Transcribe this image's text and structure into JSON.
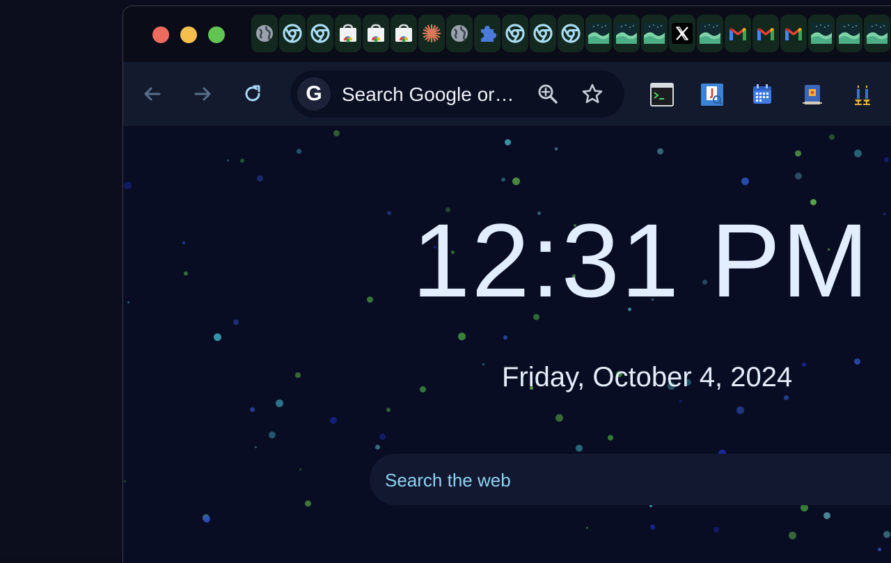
{
  "window": {
    "traffic_lights": [
      "close",
      "minimize",
      "maximize"
    ]
  },
  "tabs": [
    {
      "icon": "globe-icon"
    },
    {
      "icon": "chrome-icon"
    },
    {
      "icon": "chrome-icon"
    },
    {
      "icon": "chrome-web-store-icon"
    },
    {
      "icon": "chrome-web-store-icon"
    },
    {
      "icon": "chrome-web-store-icon"
    },
    {
      "icon": "claude-icon"
    },
    {
      "icon": "globe-icon"
    },
    {
      "icon": "puzzle-icon"
    },
    {
      "icon": "chrome-icon"
    },
    {
      "icon": "chrome-icon"
    },
    {
      "icon": "chrome-icon"
    },
    {
      "icon": "wave-icon"
    },
    {
      "icon": "wave-icon"
    },
    {
      "icon": "wave-icon"
    },
    {
      "icon": "x-icon"
    },
    {
      "icon": "wave-icon"
    },
    {
      "icon": "gmail-icon"
    },
    {
      "icon": "gmail-icon"
    },
    {
      "icon": "gmail-icon"
    },
    {
      "icon": "wave-icon"
    },
    {
      "icon": "wave-icon"
    },
    {
      "icon": "wave-icon"
    }
  ],
  "toolbar": {
    "omnibox_text": "Search Google or…",
    "google_badge": "G",
    "extensions": [
      "terminal-icon",
      "java-doc-icon",
      "calendar-icon",
      "book-icon",
      "candles-icon"
    ]
  },
  "newtab": {
    "time": "12:31 PM",
    "date": "Friday, October 4, 2024",
    "search_placeholder": "Search the web"
  },
  "colors": {
    "background": "#090d24",
    "clock_text": "#e2edff",
    "search_text": "#8fd3f2",
    "close": "#ec6a5e",
    "minimize": "#f4bf4f",
    "maximize": "#61c554"
  }
}
